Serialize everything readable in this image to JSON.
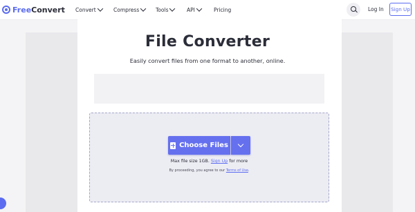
{
  "brand": {
    "part1": "Free",
    "part2": "Convert"
  },
  "nav": {
    "items": [
      {
        "label": "Convert",
        "has_dropdown": true
      },
      {
        "label": "Compress",
        "has_dropdown": true
      },
      {
        "label": "Tools",
        "has_dropdown": true
      },
      {
        "label": "API",
        "has_dropdown": true
      },
      {
        "label": "Pricing",
        "has_dropdown": false
      }
    ],
    "search_icon": "search-icon",
    "login_label": "Log In",
    "signup_label": "Sign Up"
  },
  "hero": {
    "title": "File Converter",
    "subtitle": "Easily convert files from one format to another, online."
  },
  "upload": {
    "button_label": "Choose Files",
    "max_size_prefix": "Max file size 1GB.",
    "max_size_link": "Sign Up",
    "max_size_suffix": "for more",
    "terms_prefix": "By proceeding, you agree to our",
    "terms_link": "Terms of Use",
    "terms_suffix": "."
  },
  "colors": {
    "accent": "#5b6cf0",
    "button": "#6570ef",
    "text": "#2b2d38",
    "dropzone_bg": "#ececf3"
  }
}
